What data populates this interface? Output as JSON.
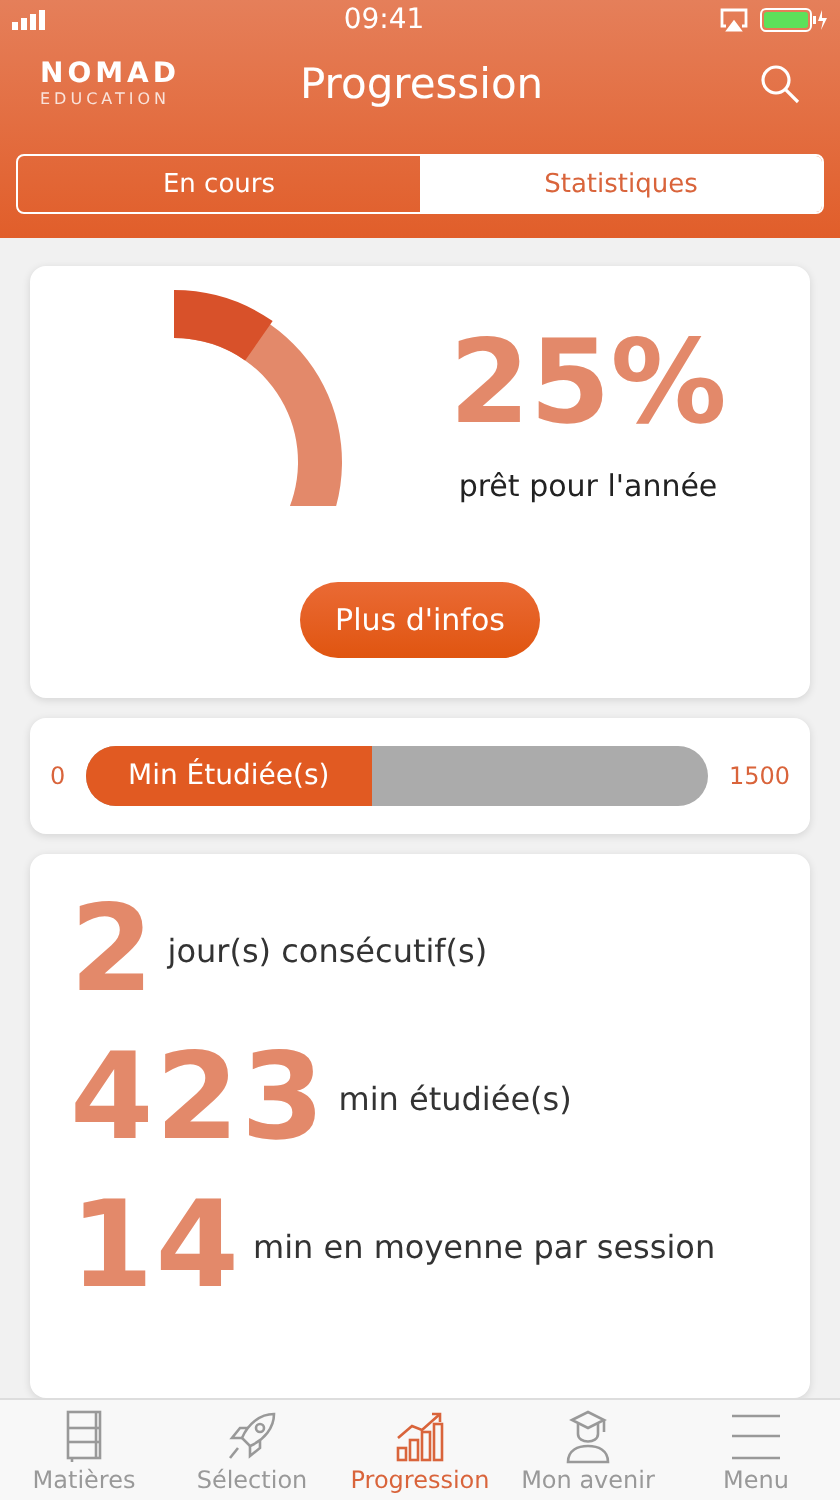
{
  "status_bar": {
    "time": "09:41"
  },
  "header": {
    "logo_top": "NOMAD",
    "logo_bottom": "EDUCATION",
    "title": "Progression"
  },
  "segments": [
    {
      "label": "En cours",
      "selected": false
    },
    {
      "label": "Statistiques",
      "selected": true
    }
  ],
  "readiness": {
    "percent": "25%",
    "caption": "prêt pour l'année",
    "button": "Plus d'infos"
  },
  "minutes_bar": {
    "min": "0",
    "max": "1500",
    "label": "Min Étudiée(s)",
    "level": 0.46
  },
  "stats": [
    {
      "value": "2",
      "label": "jour(s) consécutif(s)"
    },
    {
      "value": "423",
      "label": "min étudiée(s)"
    },
    {
      "value": "14",
      "label": "min en moyenne par session"
    }
  ],
  "tab_bar": [
    {
      "kind": "book",
      "label": "Matières",
      "selected": false
    },
    {
      "kind": "rocket",
      "label": "Sélection",
      "selected": false
    },
    {
      "kind": "chart",
      "label": "Progression",
      "selected": true
    },
    {
      "kind": "graduate",
      "label": "Mon avenir",
      "selected": false
    },
    {
      "kind": "menu",
      "label": "Menu",
      "selected": false
    }
  ]
}
